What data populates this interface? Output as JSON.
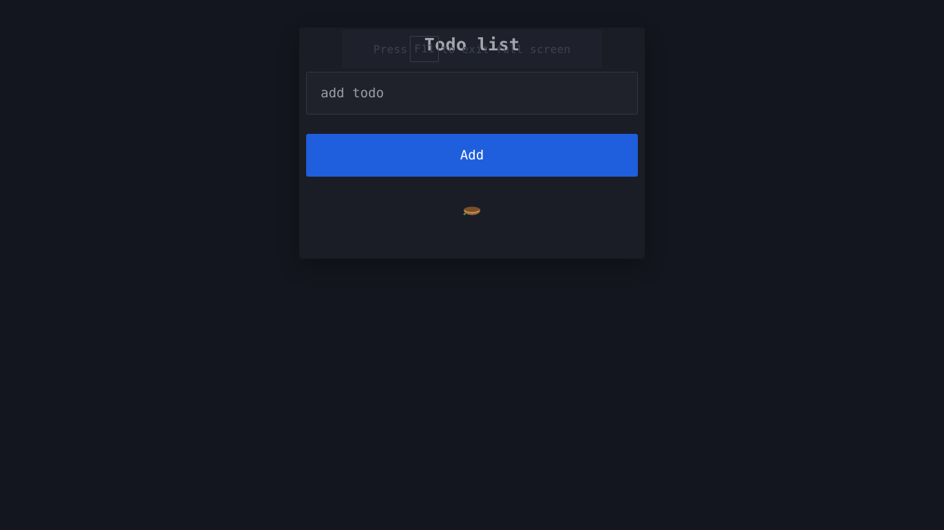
{
  "fullscreen_notice": {
    "before": "Press",
    "key": "F11",
    "after": "to exit full screen"
  },
  "todo_app": {
    "title": "Todo list",
    "input": {
      "placeholder": "add todo",
      "value": ""
    },
    "add_label": "Add",
    "empty_state_icon": "nest-icon"
  },
  "colors": {
    "background": "#13161e",
    "card": "#1a1d25",
    "accent": "#1f5fde"
  }
}
